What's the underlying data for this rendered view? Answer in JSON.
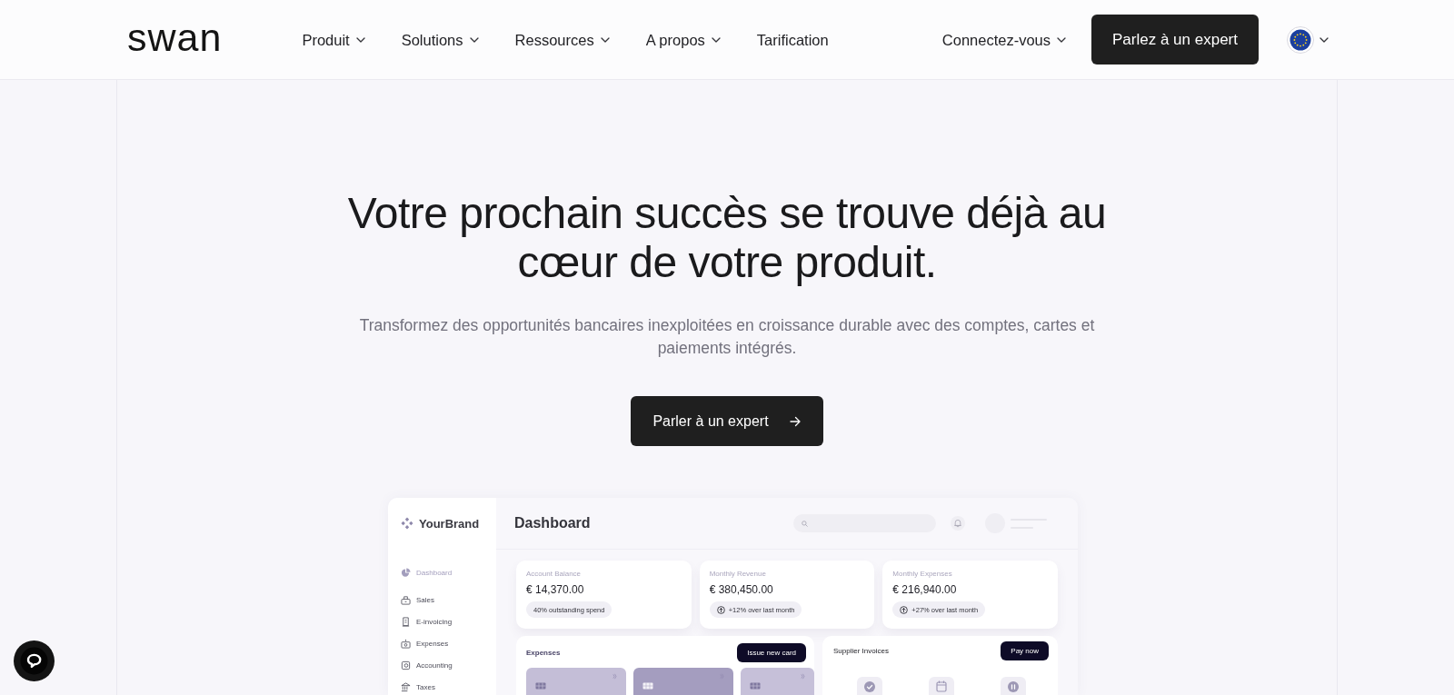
{
  "nav": {
    "logo": "swan",
    "items": [
      {
        "label": "Produit",
        "has_menu": true
      },
      {
        "label": "Solutions",
        "has_menu": true
      },
      {
        "label": "Ressources",
        "has_menu": true
      },
      {
        "label": "A propos",
        "has_menu": true
      },
      {
        "label": "Tarification",
        "has_menu": false
      }
    ],
    "login": {
      "label": "Connectez-vous",
      "has_menu": true
    },
    "cta": "Parlez à un expert"
  },
  "hero": {
    "title": "Votre prochain succès se trouve déjà au cœur de votre produit.",
    "subtitle": "Transformez des opportunités bancaires inexploitées en croissance durable avec des comptes, cartes et paiements intégrés.",
    "cta": "Parler à un expert"
  },
  "dashboard": {
    "brand": "YourBrand",
    "sidebar": [
      {
        "label": "Dashboard",
        "selected": true
      },
      {
        "label": "Sales",
        "selected": false
      },
      {
        "label": "E-invoicing",
        "selected": false
      },
      {
        "label": "Expenses",
        "selected": false
      },
      {
        "label": "Accounting",
        "selected": false
      },
      {
        "label": "Taxes",
        "selected": false
      }
    ],
    "title": "Dashboard",
    "stats": [
      {
        "kind": "plain",
        "label": "Account Balance",
        "value": "€ 14,370.00",
        "note": "40% outstanding spend"
      },
      {
        "kind": "trend",
        "label": "Monthly Revenue",
        "value": "€ 380,450.00",
        "note": "+12% over last month"
      },
      {
        "kind": "trend",
        "label": "Monthly Expenses",
        "value": "€ 216,940.00",
        "note": "+27% over last month"
      }
    ],
    "expenses": {
      "title": "Expenses",
      "action": "Issue new card"
    },
    "invoices": {
      "title": "Supplier Invoices",
      "action": "Pay now"
    }
  }
}
